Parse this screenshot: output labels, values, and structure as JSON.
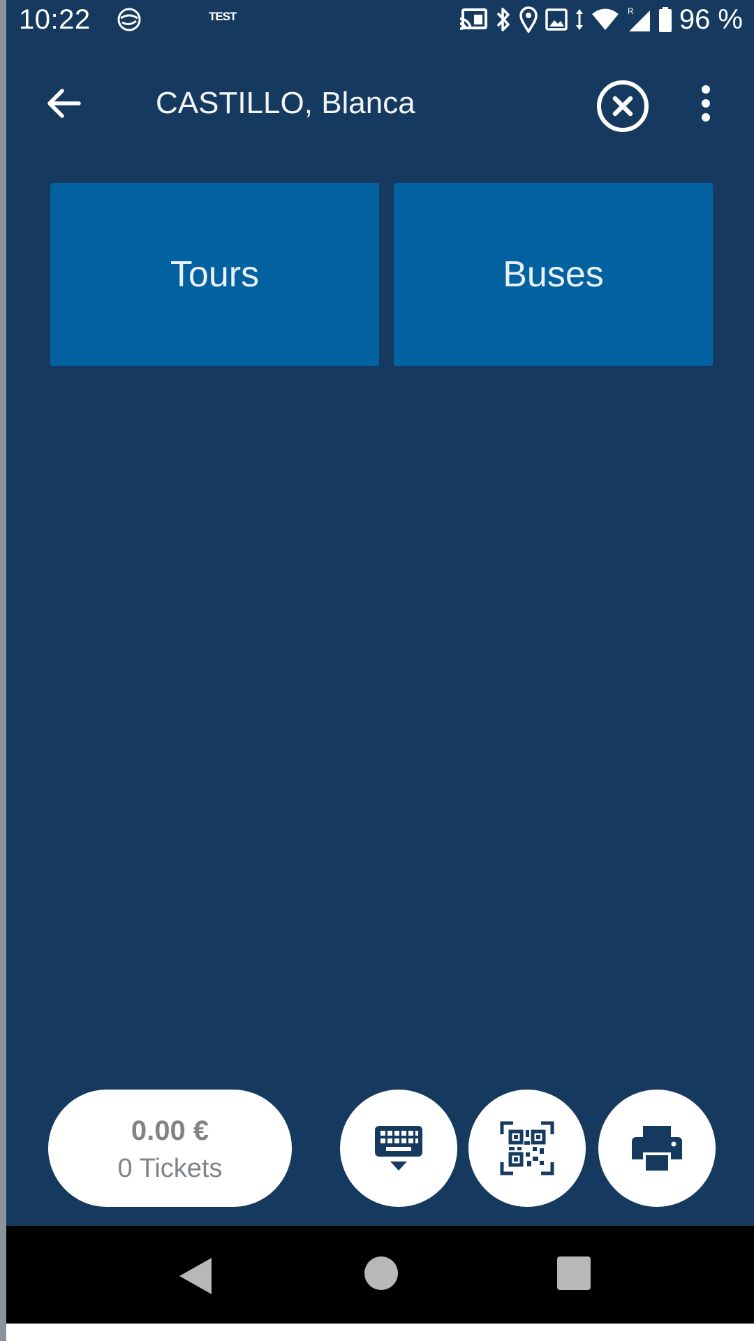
{
  "status_bar": {
    "time": "10:22",
    "test_label": "TEST",
    "battery_percent": "96 %",
    "icons": [
      "notification-app-icon",
      "cast-icon",
      "bluetooth-icon",
      "location-icon",
      "image-icon",
      "data-arrows-icon",
      "wifi-icon",
      "signal-roaming-icon",
      "battery-icon"
    ]
  },
  "app_bar": {
    "title": "CASTILLO, Blanca",
    "icons": [
      "arrow-back-icon",
      "close-circle-icon",
      "more-vert-icon"
    ]
  },
  "categories": [
    {
      "label": "Tours"
    },
    {
      "label": "Buses"
    }
  ],
  "cart": {
    "total": "0.00 €",
    "tickets": "0 Tickets"
  },
  "actions": {
    "icons": [
      "keyboard-icon",
      "qr-scan-icon",
      "printer-icon"
    ]
  },
  "nav_bar": {
    "icons": [
      "nav-back-icon",
      "nav-home-icon",
      "nav-recents-icon"
    ]
  },
  "colors": {
    "background": "#163a5f",
    "tile": "#02619f",
    "button_background": "#ffffff",
    "icon_dark": "#163a5f",
    "cart_text": "#808487"
  }
}
